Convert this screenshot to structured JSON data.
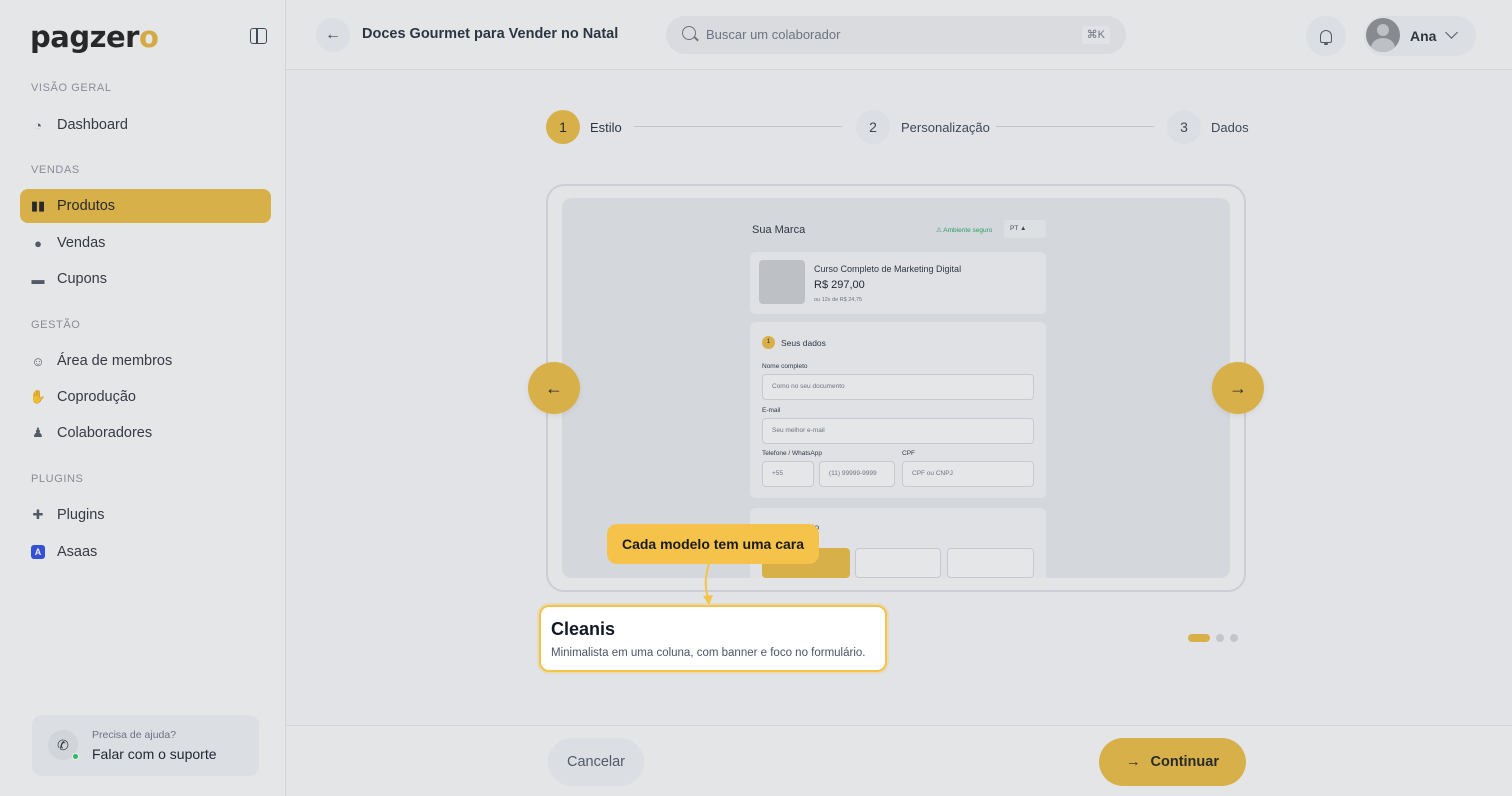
{
  "sidebar": {
    "logo_text": "pagzer",
    "logo_accent": "o",
    "sections": {
      "overview": "VISÃO GERAL",
      "sales": "VENDAS",
      "management": "GESTÃO",
      "plugins": "PLUGINS"
    },
    "items": {
      "dashboard": "Dashboard",
      "products": "Produtos",
      "sales": "Vendas",
      "coupons": "Cupons",
      "members": "Área de membros",
      "coproduction": "Coprodução",
      "collaborators": "Colaboradores",
      "plugins": "Plugins",
      "asaas": "Asaas"
    },
    "help": {
      "sub": "Precisa de ajuda?",
      "main": "Falar com o suporte"
    }
  },
  "header": {
    "title": "Doces Gourmet para Vender no Natal",
    "search_placeholder": "Buscar um colaborador",
    "search_shortcut": "⌘K",
    "user_name": "Ana"
  },
  "stepper": {
    "steps": [
      {
        "num": "1",
        "label": "Estilo"
      },
      {
        "num": "2",
        "label": "Personalização"
      },
      {
        "num": "3",
        "label": "Dados"
      }
    ]
  },
  "preview": {
    "brand": "Sua Marca",
    "secure": "⚠ Ambiente seguro",
    "lang": "PT ▲",
    "product_title": "Curso Completo de Marketing Digital",
    "price": "R$ 297,00",
    "installments": "ou 12x de R$ 24,75",
    "section_num": "1",
    "section_title": "Seus dados",
    "name_label": "Nome completo",
    "name_placeholder": "Como no seu documento",
    "email_label": "E-mail",
    "email_placeholder": "Seu melhor e-mail",
    "phone_label": "Telefone / WhatsApp",
    "phone_code": "+55",
    "phone_placeholder": "(11) 99999-9999",
    "cpf_label": "CPF",
    "cpf_placeholder": "CPF ou CNPJ",
    "payment_title_partial": "to"
  },
  "tour": {
    "tooltip": "Cada modelo tem uma cara",
    "template_name": "Cleanis",
    "template_desc": "Minimalista em uma coluna, com banner e foco no formulário."
  },
  "carousel": {
    "total": 3,
    "active": 1
  },
  "footer": {
    "cancel": "Cancelar",
    "continue": "Continuar"
  },
  "colors": {
    "accent": "#e7b93f",
    "tooltip": "#f5c34a",
    "asaas": "#2b4ae0",
    "secure": "#22a35a"
  }
}
